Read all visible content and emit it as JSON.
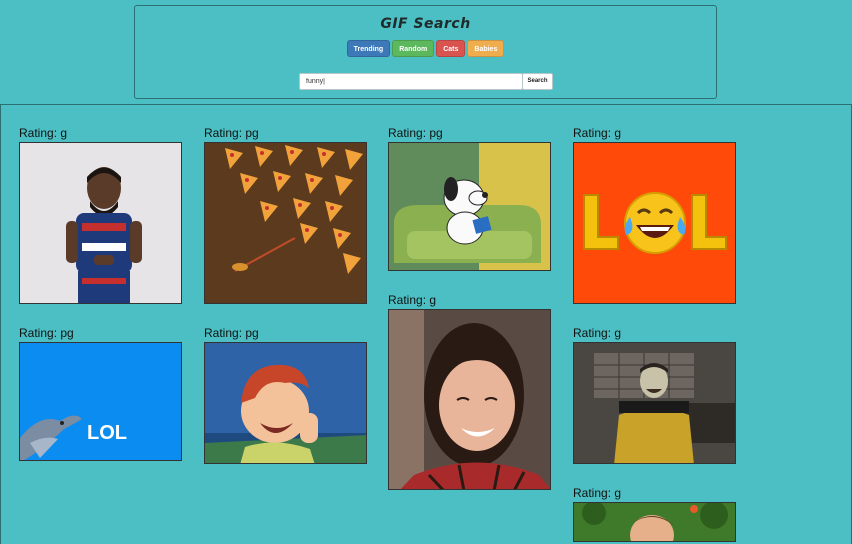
{
  "header": {
    "title": "GIF Search",
    "buttons": [
      {
        "label": "Trending",
        "color": "#3d78b8"
      },
      {
        "label": "Random",
        "color": "#5cb85c"
      },
      {
        "label": "Cats",
        "color": "#d9534f"
      },
      {
        "label": "Babies",
        "color": "#f0ad4e"
      }
    ]
  },
  "search": {
    "value": "funny|",
    "button_label": "Search"
  },
  "results": [
    {
      "rating": "Rating: g",
      "icon": "laughing-basketball-player"
    },
    {
      "rating": "Rating: pg",
      "icon": "flying-pizza-slices"
    },
    {
      "rating": "Rating: pg",
      "icon": "snoopy-reading"
    },
    {
      "rating": "Rating: g",
      "icon": "lol-crying-emoji"
    },
    {
      "rating": "Rating: pg",
      "icon": "dolphin-lol"
    },
    {
      "rating": "Rating: pg",
      "icon": "archie-laughing"
    },
    {
      "rating": "Rating: g",
      "icon": "laughing-woman"
    },
    {
      "rating": "Rating: g",
      "icon": "star-trek-data-laughing"
    },
    {
      "rating": "Rating: g",
      "icon": "laughing-man-outdoors"
    }
  ]
}
